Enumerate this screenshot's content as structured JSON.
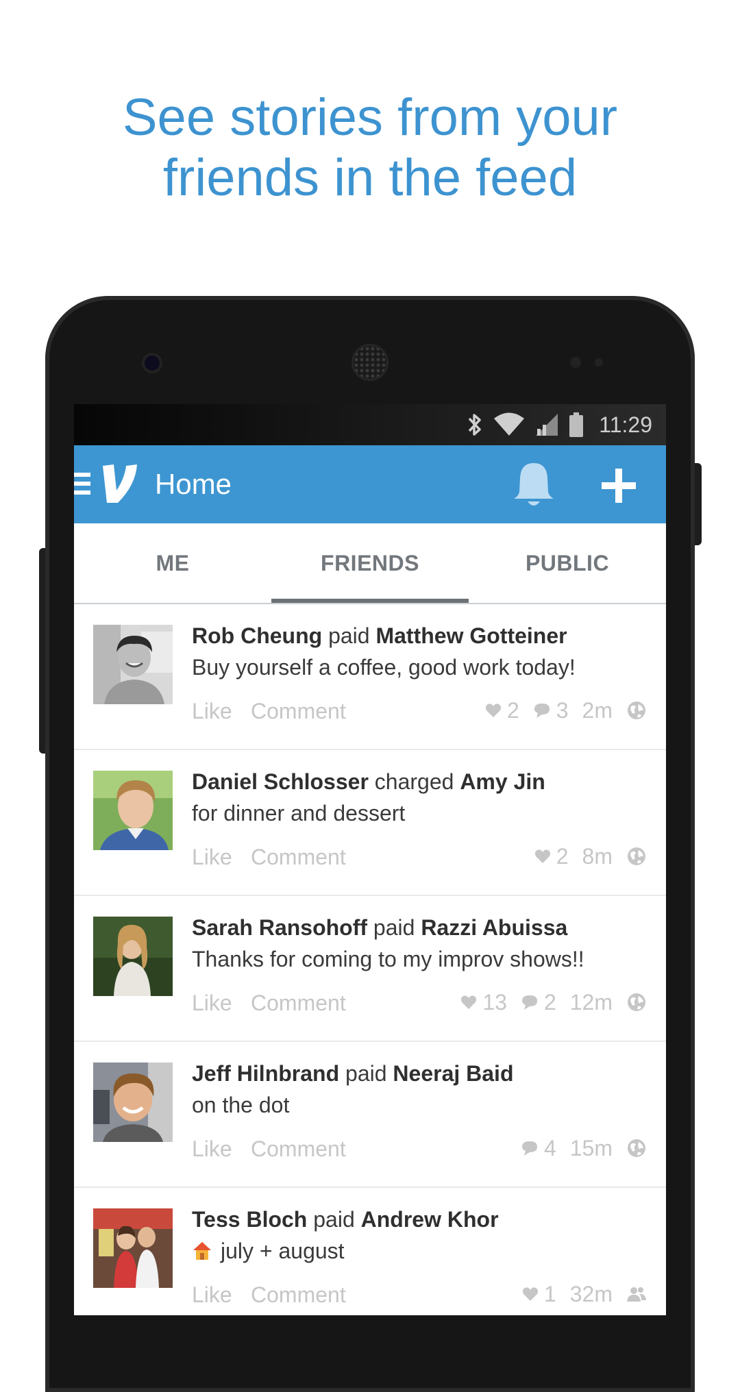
{
  "headline": {
    "line1": "See stories from your",
    "line2": "friends in the feed"
  },
  "status_bar": {
    "time": "11:29",
    "icons": [
      "bluetooth-icon",
      "wifi-icon",
      "signal-icon",
      "battery-icon"
    ]
  },
  "app_bar": {
    "title": "Home",
    "icons": [
      "menu-icon",
      "venmo-logo-icon",
      "bell-icon",
      "plus-icon"
    ],
    "color": "#3d96d1"
  },
  "tabs": [
    {
      "label": "ME",
      "selected": false
    },
    {
      "label": "FRIENDS",
      "selected": true
    },
    {
      "label": "PUBLIC",
      "selected": false
    }
  ],
  "actions": {
    "like": "Like",
    "comment": "Comment"
  },
  "stories": [
    {
      "actor": "Rob Cheung",
      "verb": "paid",
      "target": "Matthew Gotteiner",
      "message": "Buy yourself a coffee, good work today!",
      "likes": "2",
      "comments": "3",
      "time": "2m",
      "audience": "globe-icon"
    },
    {
      "actor": "Daniel Schlosser",
      "verb": "charged",
      "target": "Amy Jin",
      "message": "for dinner and dessert",
      "likes": "2",
      "comments": null,
      "time": "8m",
      "audience": "globe-icon"
    },
    {
      "actor": "Sarah Ransohoff",
      "verb": "paid",
      "target": "Razzi Abuissa",
      "message": "Thanks for coming to my improv shows!!",
      "likes": "13",
      "comments": "2",
      "time": "12m",
      "audience": "globe-icon"
    },
    {
      "actor": "Jeff Hilnbrand",
      "verb": "paid",
      "target": "Neeraj Baid",
      "message": "on the dot",
      "likes": null,
      "comments": "4",
      "time": "15m",
      "audience": "globe-icon"
    },
    {
      "actor": "Tess Bloch",
      "verb": "paid",
      "target": "Andrew Khor",
      "message": "july + august",
      "message_icon": "house-icon",
      "likes": "1",
      "comments": null,
      "time": "32m",
      "audience": "friends-icon"
    }
  ]
}
